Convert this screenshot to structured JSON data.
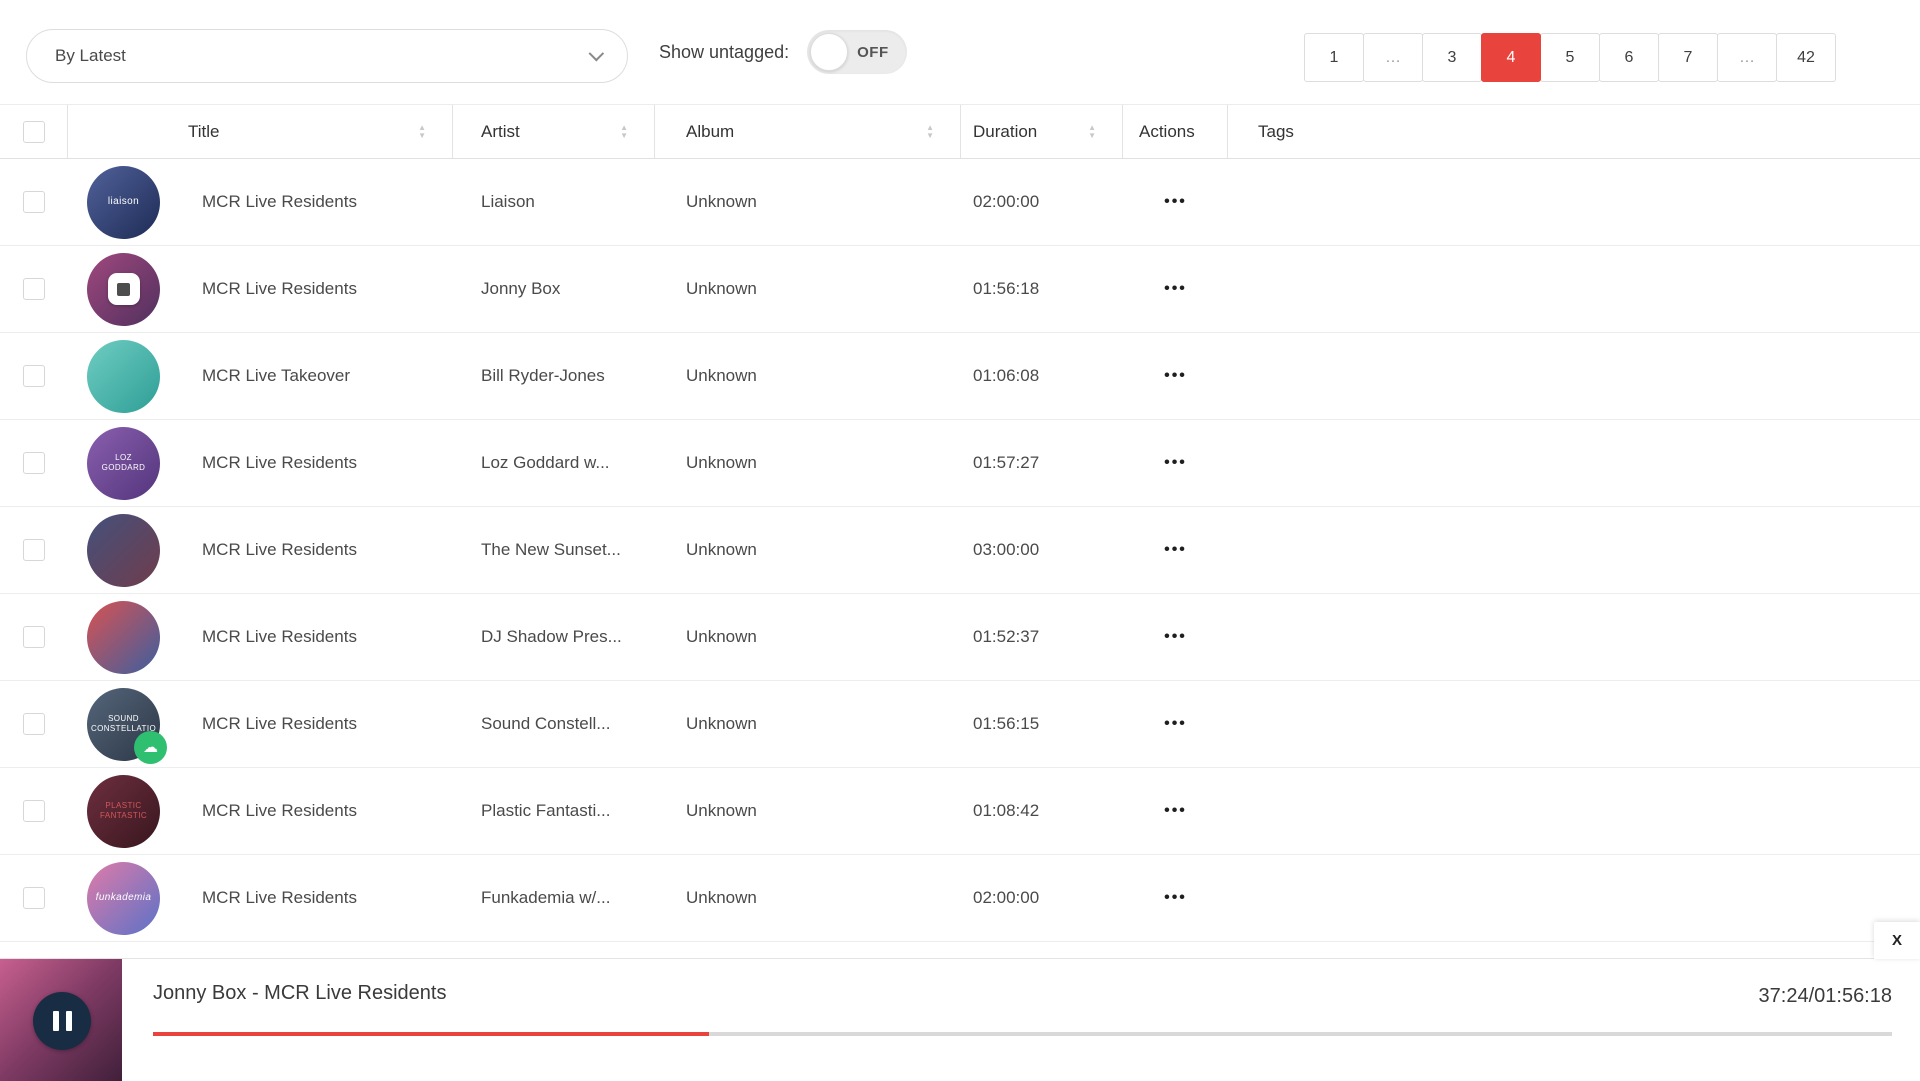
{
  "toolbar": {
    "sort_label": "By Latest",
    "untagged_label": "Show untagged:",
    "toggle_state": "OFF"
  },
  "pagination": {
    "pages": [
      "1",
      "…",
      "3",
      "4",
      "5",
      "6",
      "7",
      "…",
      "42"
    ],
    "active_page": "4"
  },
  "table": {
    "headers": {
      "title": "Title",
      "artist": "Artist",
      "album": "Album",
      "duration": "Duration",
      "actions": "Actions",
      "tags": "Tags"
    },
    "rows": [
      {
        "title": "MCR Live Residents",
        "artist": "Liaison",
        "album": "Unknown",
        "duration": "02:00:00",
        "thumb_text": "liaison",
        "thumb_colors": [
          "#51629b",
          "#1e2b55"
        ]
      },
      {
        "title": "MCR Live Residents",
        "artist": "Jonny Box",
        "album": "Unknown",
        "duration": "01:56:18",
        "thumb_text": "",
        "thumb_colors": [
          "#a0487e",
          "#50305e"
        ],
        "playing": true
      },
      {
        "title": "MCR Live Takeover",
        "artist": "Bill Ryder-Jones",
        "album": "Unknown",
        "duration": "01:06:08",
        "thumb_text": "",
        "thumb_colors": [
          "#6fcdc2",
          "#2e9e96"
        ]
      },
      {
        "title": "MCR Live Residents",
        "artist": "Loz Goddard w...",
        "album": "Unknown",
        "duration": "01:57:27",
        "thumb_text": "LOZ GODDARD",
        "thumb_colors": [
          "#8a5fae",
          "#53357c"
        ]
      },
      {
        "title": "MCR Live Residents",
        "artist": "The New Sunset...",
        "album": "Unknown",
        "duration": "03:00:00",
        "thumb_text": "",
        "thumb_colors": [
          "#44517c",
          "#703c4c"
        ]
      },
      {
        "title": "MCR Live Residents",
        "artist": "DJ Shadow Pres...",
        "album": "Unknown",
        "duration": "01:52:37",
        "thumb_text": "",
        "thumb_colors": [
          "#d95252",
          "#3b5fa0"
        ]
      },
      {
        "title": "MCR Live Residents",
        "artist": "Sound Constell...",
        "album": "Unknown",
        "duration": "01:56:15",
        "thumb_text": "SOUND CONSTELLATIO",
        "thumb_colors": [
          "#55657a",
          "#2c3847"
        ],
        "cloud_badge": true
      },
      {
        "title": "MCR Live Residents",
        "artist": "Plastic Fantasti...",
        "album": "Unknown",
        "duration": "01:08:42",
        "thumb_text": "PLASTIC FANTASTIC",
        "thumb_colors": [
          "#6e2f3f",
          "#38161f"
        ],
        "thumb_text_color": "#d05858"
      },
      {
        "title": "MCR Live Residents",
        "artist": "Funkademia w/...",
        "album": "Unknown",
        "duration": "02:00:00",
        "thumb_text": "funkademia",
        "thumb_colors": [
          "#e07ba8",
          "#5a72c8"
        ]
      }
    ]
  },
  "player": {
    "track": "Jonny Box - MCR Live Residents",
    "time": "37:24/01:56:18",
    "progress_percent": 32,
    "close_label": "X",
    "art_colors": [
      "#c7608f",
      "#7e3a63",
      "#40203a"
    ]
  },
  "icons": {
    "sort_asc": "▲",
    "sort_desc": "▼",
    "more": "•••",
    "cloud": "☁"
  },
  "colors": {
    "accent_red": "#e8433d",
    "progress_track": "#d9d9d9",
    "border": "#e3e3e3"
  }
}
